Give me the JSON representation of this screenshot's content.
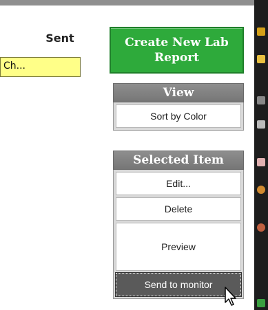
{
  "table": {
    "column_header": "Sent",
    "cell_value": "Ch..."
  },
  "actions": {
    "create_label": "Create New Lab Report"
  },
  "view_section": {
    "header": "View",
    "items": [
      "Sort by Color"
    ]
  },
  "selected_section": {
    "header": "Selected Item",
    "items": [
      "Edit...",
      "Delete",
      "Preview",
      "Send to monitor"
    ]
  },
  "colors": {
    "create_button": "#2eaa3b",
    "section_header": "#808080",
    "highlight_field": "#ffff88",
    "active_button": "#5a5a5a"
  }
}
